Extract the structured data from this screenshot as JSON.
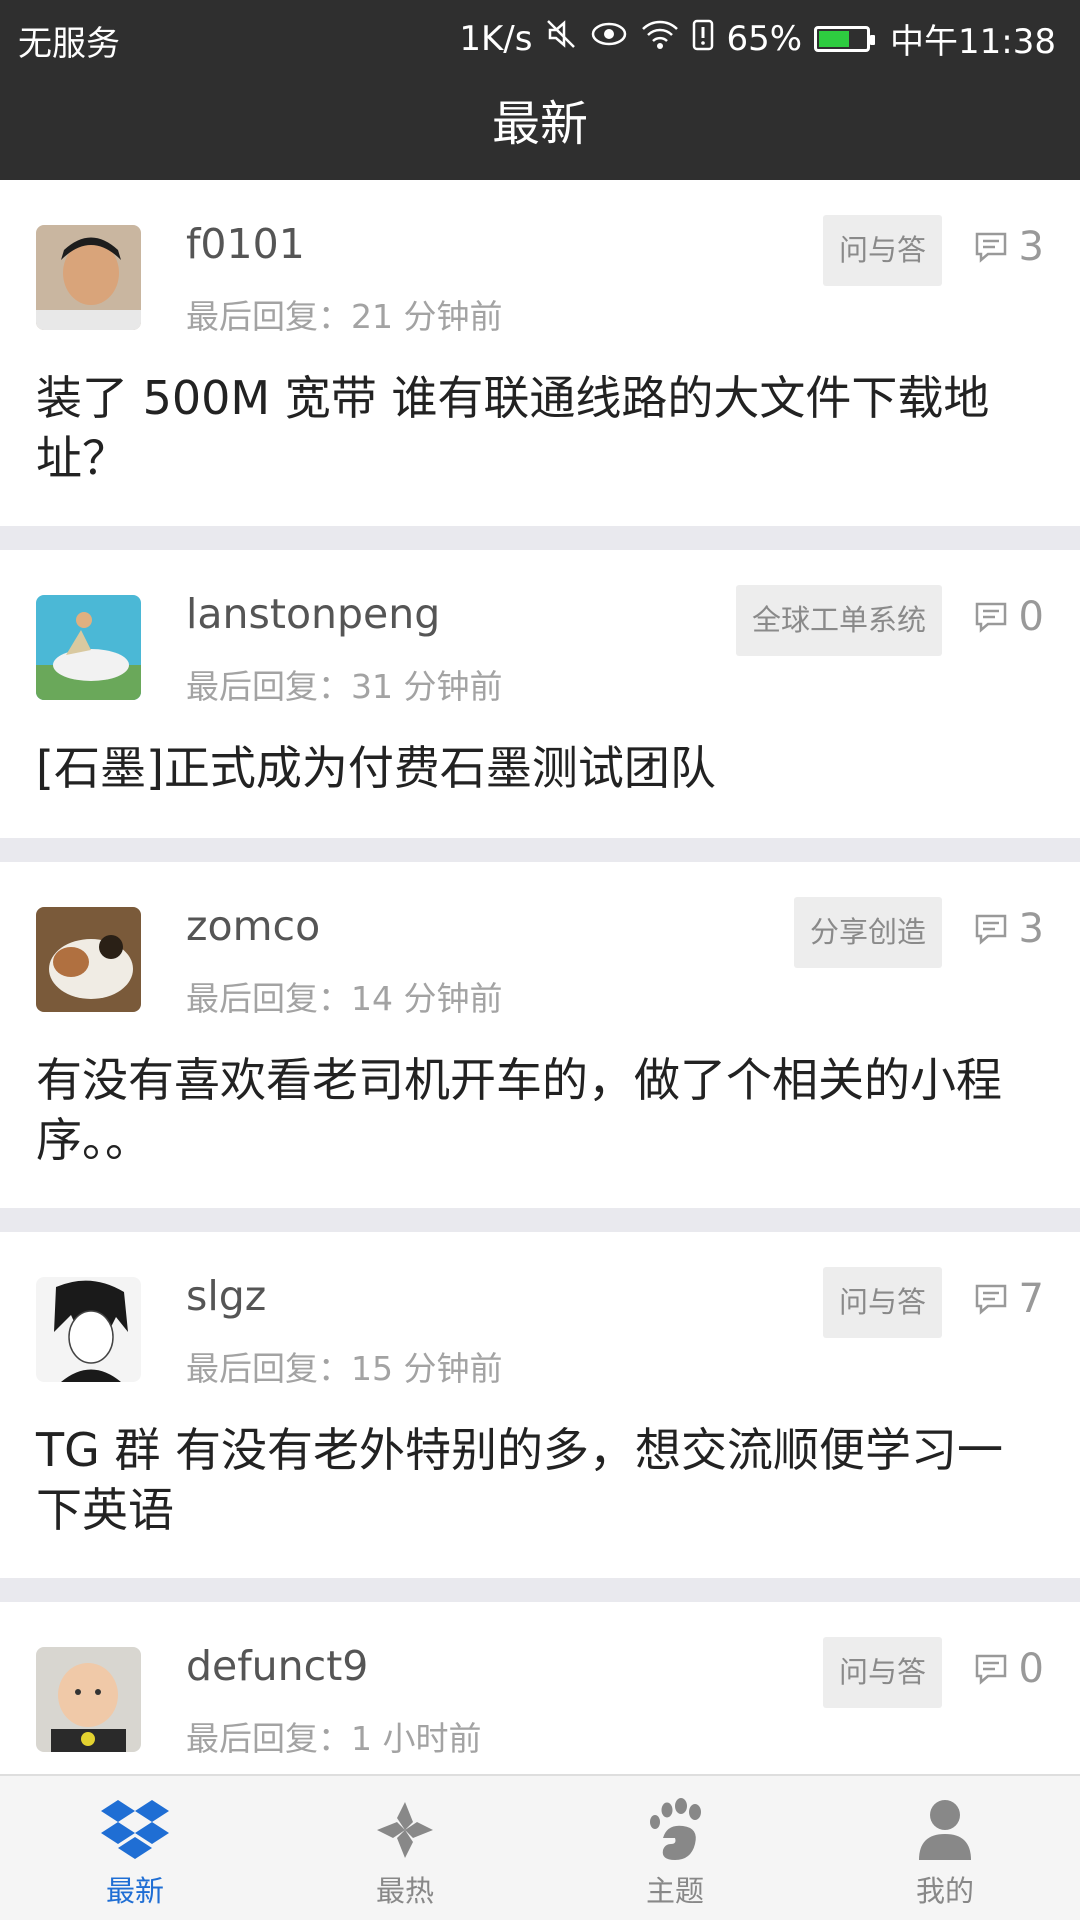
{
  "status_bar": {
    "carrier": "无服务",
    "net_speed": "1K/s",
    "battery_pct": "65%",
    "battery_level": 0.65,
    "time": "中午11:38"
  },
  "header": {
    "title": "最新"
  },
  "posts": [
    {
      "username": "f0101",
      "last_reply": "最后回复：21 分钟前",
      "tag": "问与答",
      "comments": "3",
      "title": "装了 500M 宽带 谁有联通线路的大文件下载地址？"
    },
    {
      "username": "lanstonpeng",
      "last_reply": "最后回复：31 分钟前",
      "tag": "全球工单系统",
      "comments": "0",
      "title": "[石墨]正式成为付费石墨测试团队"
    },
    {
      "username": "zomco",
      "last_reply": "最后回复：14 分钟前",
      "tag": "分享创造",
      "comments": "3",
      "title": "有没有喜欢看老司机开车的，做了个相关的小程序。。"
    },
    {
      "username": "slgz",
      "last_reply": "最后回复：15 分钟前",
      "tag": "问与答",
      "comments": "7",
      "title": "TG 群 有没有老外特别的多，想交流顺便学习一下英语"
    },
    {
      "username": "defunct9",
      "last_reply": "最后回复：1 小时前",
      "tag": "问与答",
      "comments": "0",
      "title": ""
    }
  ],
  "tabs": [
    {
      "label": "最新",
      "icon": "dropbox-icon",
      "active": true
    },
    {
      "label": "最热",
      "icon": "pinwheel-icon",
      "active": false
    },
    {
      "label": "主题",
      "icon": "footprint-icon",
      "active": false
    },
    {
      "label": "我的",
      "icon": "person-icon",
      "active": false
    }
  ],
  "colors": {
    "header_bg": "#2f2f2f",
    "accent": "#1f6ed4",
    "tag_bg": "#ededed",
    "separator": "#e9e9ee"
  }
}
